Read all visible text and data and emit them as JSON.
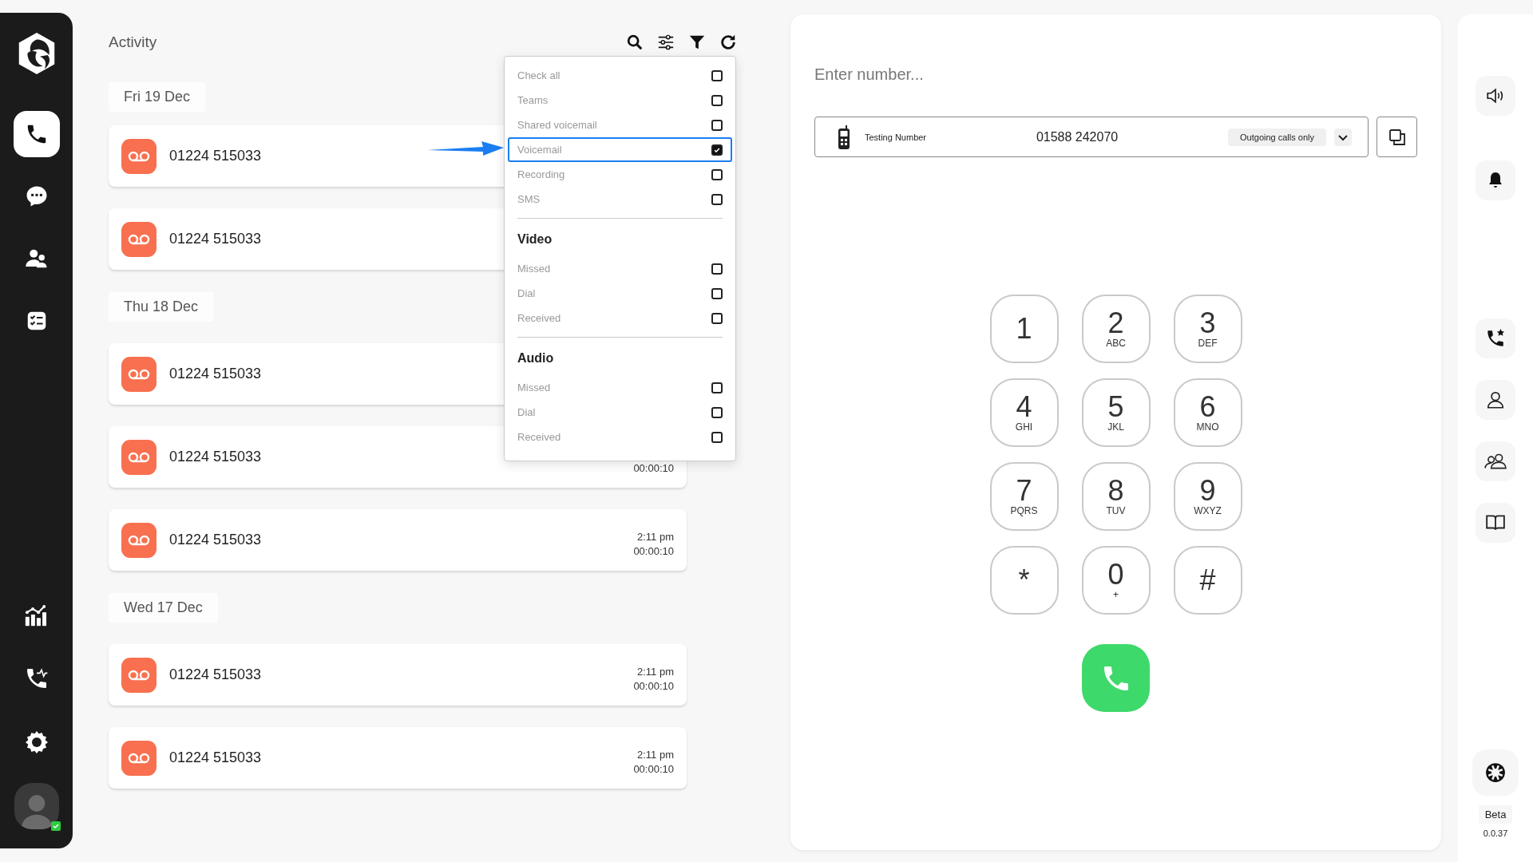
{
  "sidebar": {
    "nav_items": [
      {
        "selected": true
      },
      {
        "selected": false
      },
      {
        "selected": false
      },
      {
        "selected": false
      }
    ],
    "bottom_items": [
      {
        "selected": false
      },
      {
        "selected": false
      },
      {
        "selected": false
      }
    ],
    "user": {
      "online": true
    }
  },
  "activity": {
    "title": "Activity",
    "groups": [
      {
        "date": "Fri 19 Dec",
        "calls": [
          {
            "number": "01224 515033"
          },
          {
            "number": "01224 515033"
          }
        ]
      },
      {
        "date": "Thu 18 Dec",
        "calls": [
          {
            "number": "01224 515033"
          },
          {
            "number": "01224 515033",
            "duration": "00:00:10"
          },
          {
            "number": "01224 515033",
            "time": "2:11 pm",
            "duration": "00:00:10"
          }
        ]
      },
      {
        "date": "Wed 17 Dec",
        "calls": [
          {
            "number": "01224 515033",
            "time": "2:11 pm",
            "duration": "00:00:10"
          },
          {
            "number": "01224 515033",
            "time": "2:11 pm",
            "duration": "00:00:10"
          }
        ]
      }
    ]
  },
  "filter_menu": {
    "sections": [
      {
        "items": [
          {
            "label": "Check all",
            "checked": false,
            "highlighted": false
          },
          {
            "label": "Teams",
            "checked": false,
            "highlighted": false
          },
          {
            "label": "Shared voicemail",
            "checked": false,
            "highlighted": false
          },
          {
            "label": "Voicemail",
            "checked": true,
            "highlighted": true
          },
          {
            "label": "Recording",
            "checked": false,
            "highlighted": false
          },
          {
            "label": "SMS",
            "checked": false,
            "highlighted": false
          }
        ]
      },
      {
        "heading": "Video",
        "items": [
          {
            "label": "Missed",
            "checked": false,
            "highlighted": false
          },
          {
            "label": "Dial",
            "checked": false,
            "highlighted": false
          },
          {
            "label": "Received",
            "checked": false,
            "highlighted": false
          }
        ]
      },
      {
        "heading": "Audio",
        "items": [
          {
            "label": "Missed",
            "checked": false,
            "highlighted": false
          },
          {
            "label": "Dial",
            "checked": false,
            "highlighted": false
          },
          {
            "label": "Received",
            "checked": false,
            "highlighted": false
          }
        ]
      }
    ]
  },
  "dialer": {
    "placeholder": "Enter number...",
    "line": {
      "name": "Testing Number",
      "number": "01588 242070",
      "badge": "Outgoing calls only"
    },
    "keys": [
      {
        "digit": "1"
      },
      {
        "digit": "2",
        "letters": "ABC"
      },
      {
        "digit": "3",
        "letters": "DEF"
      },
      {
        "digit": "4",
        "letters": "GHI"
      },
      {
        "digit": "5",
        "letters": "JKL"
      },
      {
        "digit": "6",
        "letters": "MNO"
      },
      {
        "digit": "7",
        "letters": "PQRS"
      },
      {
        "digit": "8",
        "letters": "TUV"
      },
      {
        "digit": "9",
        "letters": "WXYZ"
      },
      {
        "digit": "*"
      },
      {
        "digit": "0",
        "letters": "+"
      },
      {
        "digit": "#"
      }
    ]
  },
  "right_panel": {
    "beta": "Beta",
    "version": "0.0.37"
  }
}
